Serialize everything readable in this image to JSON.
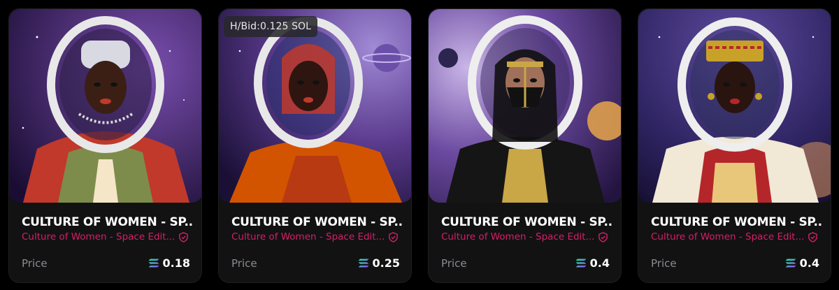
{
  "cards": [
    {
      "title": "CULTURE OF WOMEN - SP...",
      "collection": "Culture of Women - Space Edit...",
      "price_label": "Price",
      "price": "0.18",
      "art": {
        "sky": "#3a1d5e",
        "accent": "#c0392b",
        "skin": "#3b1f14",
        "headwear": "#e9ecef"
      }
    },
    {
      "title": "CULTURE OF WOMEN - SP...",
      "collection": "Culture of Women - Space Edit...",
      "price_label": "Price",
      "price": "0.25",
      "bid_badge": "H/Bid:0.125 SOL",
      "art": {
        "sky": "#4a2a78",
        "accent": "#d35400",
        "skin": "#2e1510",
        "headwear": "#c0392b"
      }
    },
    {
      "title": "CULTURE OF WOMEN - SP...",
      "collection": "Culture of Women - Space Edit...",
      "price_label": "Price",
      "price": "0.4",
      "art": {
        "sky": "#5b3d8a",
        "accent": "#111111",
        "skin": "#a0705a",
        "headwear": "#111111"
      }
    },
    {
      "title": "CULTURE OF WOMEN - SP...",
      "collection": "Culture of Women - Space Edit...",
      "price_label": "Price",
      "price": "0.4",
      "art": {
        "sky": "#2a1f4f",
        "accent": "#f1e8d6",
        "skin": "#2a1410",
        "headwear": "#c8a228"
      }
    }
  ],
  "colors": {
    "collection_text": "#d61f69",
    "verified_badge": "#d61f69",
    "sol_gradient": [
      "#9945ff",
      "#14f195"
    ]
  },
  "icons": {
    "verified": "verified-shield-icon",
    "currency": "solana-icon"
  }
}
